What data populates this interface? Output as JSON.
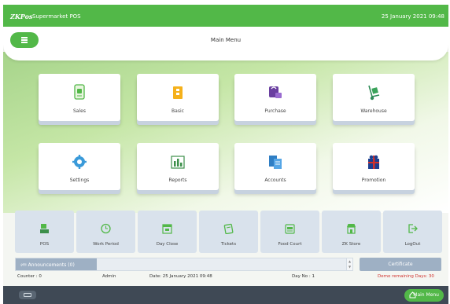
{
  "titlebar": {
    "logo": "ZKPos",
    "app_name": "Supermarket POS",
    "datetime": "25 January 2021 09:48"
  },
  "header": {
    "title": "Main Menu"
  },
  "main_tiles": [
    {
      "label": "Sales",
      "icon": "receipt-icon"
    },
    {
      "label": "Basic",
      "icon": "box-icon"
    },
    {
      "label": "Purchase",
      "icon": "shopping-bag-icon"
    },
    {
      "label": "Warehouse",
      "icon": "hand-truck-icon"
    },
    {
      "label": "Settings",
      "icon": "gear-icon"
    },
    {
      "label": "Reports",
      "icon": "bar-chart-icon"
    },
    {
      "label": "Accounts",
      "icon": "ledger-icon"
    },
    {
      "label": "Promotion",
      "icon": "gift-icon"
    }
  ],
  "bottom_tiles": [
    {
      "label": "POS",
      "icon": "pos-terminal-icon"
    },
    {
      "label": "Work Period",
      "icon": "clock-icon"
    },
    {
      "label": "Day Close",
      "icon": "calendar-icon"
    },
    {
      "label": "Tickets",
      "icon": "ticket-icon"
    },
    {
      "label": "Food Court",
      "icon": "food-court-icon"
    },
    {
      "label": "ZK Store",
      "icon": "store-icon"
    },
    {
      "label": "LogOut",
      "icon": "logout-icon"
    }
  ],
  "announcements": {
    "label": "Announcements (0)"
  },
  "certificate": {
    "label": "Certificate"
  },
  "status": {
    "counter": "Counter : 0",
    "user": "Admin",
    "date": "Date: 25 January 2021 09:48",
    "day_no": "Day No : 1",
    "demo": "Demo remaining Days:  30"
  },
  "bottombar": {
    "main_menu_label": "Main Menu"
  },
  "colors": {
    "brand_green": "#52b848",
    "tile_gray_blue": "#d9e2ec",
    "bottom_bar": "#3f4955",
    "demo_red": "#d0312d"
  }
}
